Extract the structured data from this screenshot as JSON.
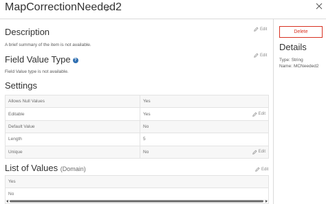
{
  "header": {
    "title": "MapCorrectionNeeded2"
  },
  "description": {
    "heading": "Description",
    "text": "A brief summary of the item is not available.",
    "edit_label": "Edit"
  },
  "field_value_type": {
    "heading": "Field Value Type",
    "text": "Field Value type is not available.",
    "edit_label": "Edit"
  },
  "settings": {
    "heading": "Settings",
    "rows": [
      {
        "label": "Allows Null Values",
        "value": "Yes",
        "edit": ""
      },
      {
        "label": "Editable",
        "value": "Yes",
        "edit": "Edit"
      },
      {
        "label": "Default Value",
        "value": "No",
        "edit": ""
      },
      {
        "label": "Length",
        "value": "5",
        "edit": ""
      },
      {
        "label": "Unique",
        "value": "No",
        "edit": "Edit"
      }
    ]
  },
  "list_of_values": {
    "heading": "List of Values",
    "qualifier": "(Domain)",
    "edit_label": "Edit",
    "values": [
      "Yes",
      "No"
    ]
  },
  "sidebar": {
    "delete_label": "Delete",
    "details_heading": "Details",
    "type_line": "Type: String",
    "name_line": "Name: MCNeeded2"
  },
  "colors": {
    "accent_red": "#d83020",
    "info_blue": "#2f6fb1"
  }
}
